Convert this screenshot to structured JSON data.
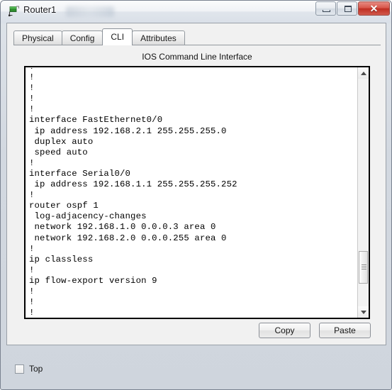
{
  "window": {
    "title": "Router1",
    "icon": "router-icon",
    "buttons": {
      "minimize": "minimize-button",
      "maximize": "maximize-button",
      "close_label": "✕"
    }
  },
  "tabs": [
    {
      "label": "Physical",
      "active": false
    },
    {
      "label": "Config",
      "active": false
    },
    {
      "label": "CLI",
      "active": true
    },
    {
      "label": "Attributes",
      "active": false
    }
  ],
  "cli": {
    "header": "IOS Command Line Interface",
    "content": "!\n!\n!\n!\n!\ninterface FastEthernet0/0\n ip address 192.168.2.1 255.255.255.0\n duplex auto\n speed auto\n!\ninterface Serial0/0\n ip address 192.168.1.1 255.255.255.252\n!\nrouter ospf 1\n log-adjacency-changes\n network 192.168.1.0 0.0.0.3 area 0\n network 192.168.2.0 0.0.0.255 area 0\n!\nip classless\n!\nip flow-export version 9\n!\n!\n!\n!\n!\n!",
    "scrollbar": {
      "up_arrow": "▲",
      "down_arrow": "▼"
    }
  },
  "actions": {
    "copy_label": "Copy",
    "paste_label": "Paste"
  },
  "options": {
    "top_label": "Top",
    "top_checked": false
  },
  "colors": {
    "terminal_border": "#000000",
    "terminal_bg": "#ffffff",
    "panel_bg": "#f1f1f1",
    "close_button": "#bf2e22"
  }
}
